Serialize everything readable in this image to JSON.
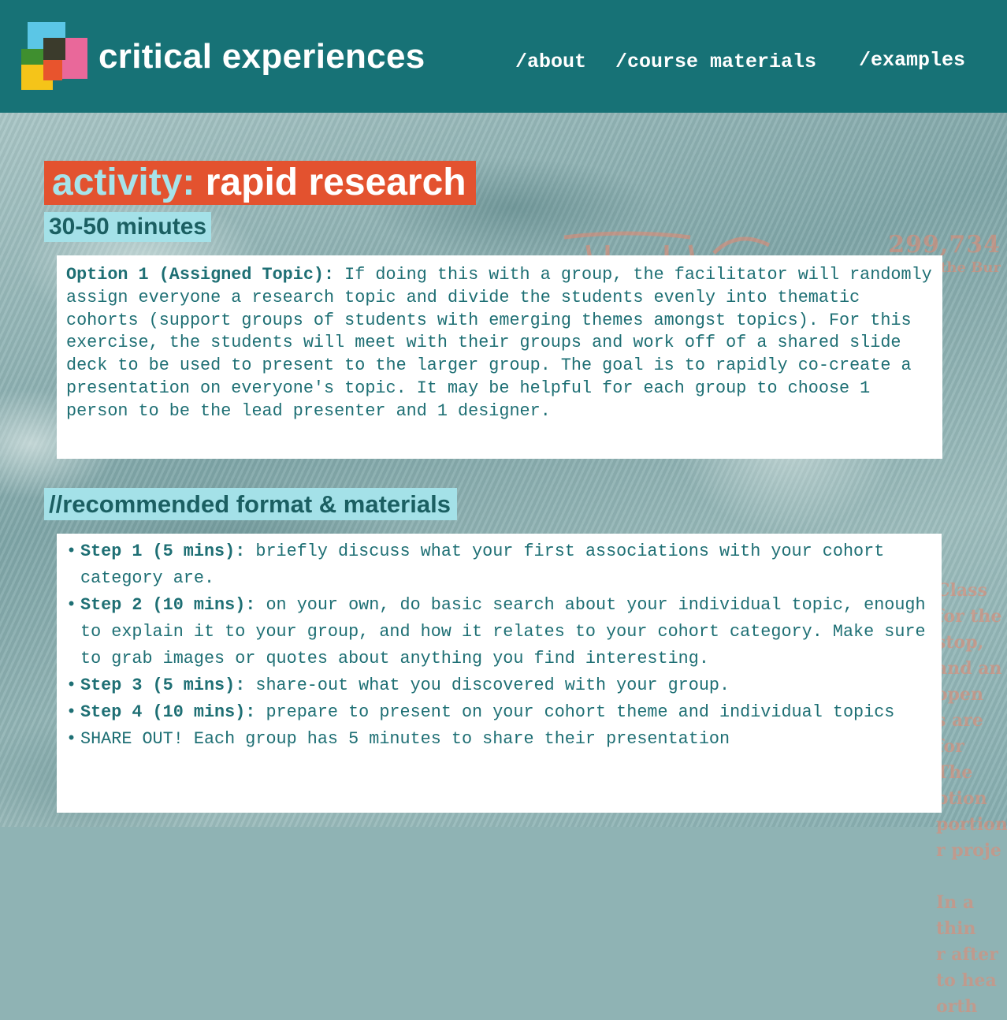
{
  "header": {
    "brand": "critical experiences",
    "nav": {
      "about": "/about",
      "course_materials": "/course materials",
      "examples": "/examples"
    }
  },
  "activity": {
    "label": "activity:",
    "name": "rapid research",
    "duration": "30-50 minutes"
  },
  "option": {
    "label": "Option 1 (Assigned Topic):",
    "text": " If doing this with a group, the facilitator will randomly assign everyone a research topic and divide the students evenly into thematic cohorts (support groups of students with emerging themes amongst topics). For this exercise, the students will meet with their groups and work off of a shared slide deck to be used to present to the larger group. The goal is to rapidly co-create a presentation on everyone's topic. It may be helpful for each group to choose 1 person to be the lead presenter and 1 designer."
  },
  "format": {
    "heading": "//recommended format & materials",
    "steps": [
      {
        "label": "Step 1 (5 mins):",
        "text": " briefly discuss what your first associations with your cohort category are."
      },
      {
        "label": "Step 2 (10 mins):",
        "text": " on your own, do basic search about your individual topic, enough to explain it to your group, and how it relates to your cohort category. Make sure to grab images or quotes about anything you find interesting."
      },
      {
        "label": "Step 3 (5 mins):",
        "text": " share-out what you discovered with your group."
      },
      {
        "label": "Step 4 (10 mins):",
        "text": " prepare to present on your cohort theme and individual topics"
      },
      {
        "label": "",
        "text": "SHARE OUT! Each group has 5 minutes to share their presentation"
      }
    ]
  },
  "background_text": {
    "number": "299,734",
    "sub": "to the Bur",
    "side": [
      "Class",
      "for the stop,",
      "and an open",
      "s are for",
      "The",
      "ption",
      "portion",
      "r proje",
      "",
      "In a",
      "thin",
      "r after",
      "to hea",
      "orth"
    ]
  },
  "colors": {
    "header": "#177276",
    "title_bg": "#e3522f",
    "title_accent": "#a6e3ea",
    "tag_bg": "#a4e1e8",
    "body_text": "#1e6f74",
    "deco": "#e9876e"
  }
}
